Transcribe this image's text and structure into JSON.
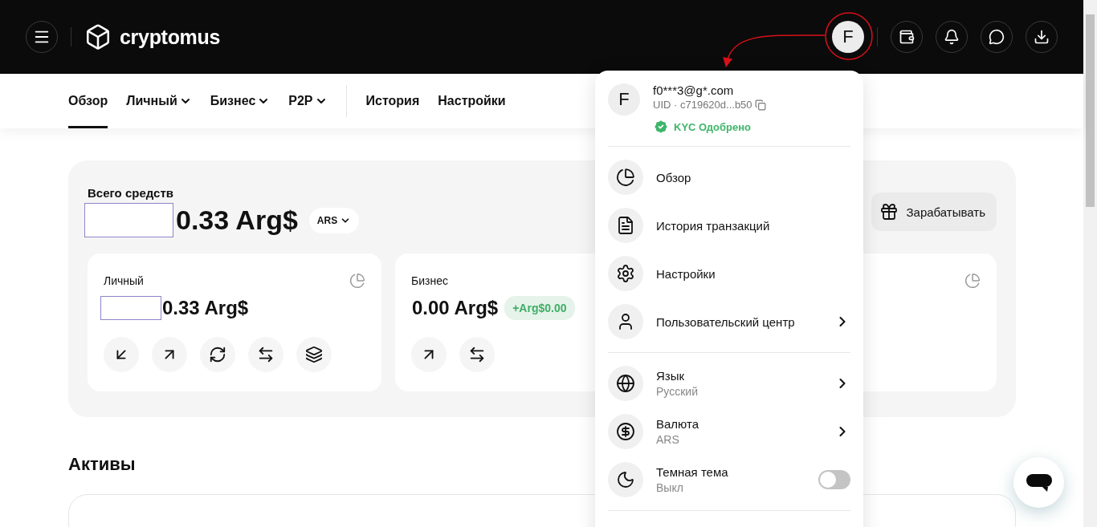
{
  "header": {
    "logo_text": "cryptomus",
    "avatar_letter": "F"
  },
  "nav": {
    "primary": [
      {
        "label": "Обзор",
        "selected": true,
        "dropdown": false
      },
      {
        "label": "Личный",
        "selected": false,
        "dropdown": true
      },
      {
        "label": "Бизнес",
        "selected": false,
        "dropdown": true
      },
      {
        "label": "P2P",
        "selected": false,
        "dropdown": true
      }
    ],
    "secondary": [
      {
        "label": "История",
        "selected": false,
        "dropdown": false
      },
      {
        "label": "Настройки",
        "selected": false,
        "dropdown": false
      }
    ]
  },
  "summary": {
    "title": "Всего средств",
    "redacted": true,
    "amount": "0.33 Arg$",
    "currency": "ARS",
    "earn_button": "Зарабатывать"
  },
  "wallets": [
    {
      "name": "Личный",
      "redacted": true,
      "amount": "0.33 Arg$",
      "actions": [
        {
          "kind": "receive"
        },
        {
          "kind": "send"
        },
        {
          "kind": "swap"
        },
        {
          "kind": "transfer"
        },
        {
          "kind": "stake"
        }
      ]
    },
    {
      "name": "Бизнес",
      "redacted": false,
      "amount": "0.00 Arg$",
      "change": "+Arg$0.00",
      "actions": [
        {
          "kind": "send"
        },
        {
          "kind": "transfer"
        }
      ]
    },
    {
      "kind": "covered"
    }
  ],
  "assets": {
    "title": "Активы"
  },
  "menu": {
    "avatar_letter": "F",
    "email": "f0***3@g*.com",
    "uid": "UID · c719620d...b50",
    "kyc": "KYC Одобрено",
    "sections": [
      [
        {
          "kind": "link",
          "label": "Обзор"
        },
        {
          "kind": "link",
          "label": "История транзакций"
        },
        {
          "kind": "link",
          "label": "Настройки"
        },
        {
          "kind": "submenu",
          "label": "Пользовательский центр"
        }
      ],
      [
        {
          "kind": "submenu",
          "label": "Язык",
          "sub": "Русский"
        },
        {
          "kind": "submenu",
          "label": "Валюта",
          "sub": "ARS"
        },
        {
          "kind": "toggle",
          "label": "Темная тема",
          "sub": "Выкл",
          "on": false
        }
      ]
    ]
  },
  "annotation": {
    "kind": "circle-arrow"
  }
}
